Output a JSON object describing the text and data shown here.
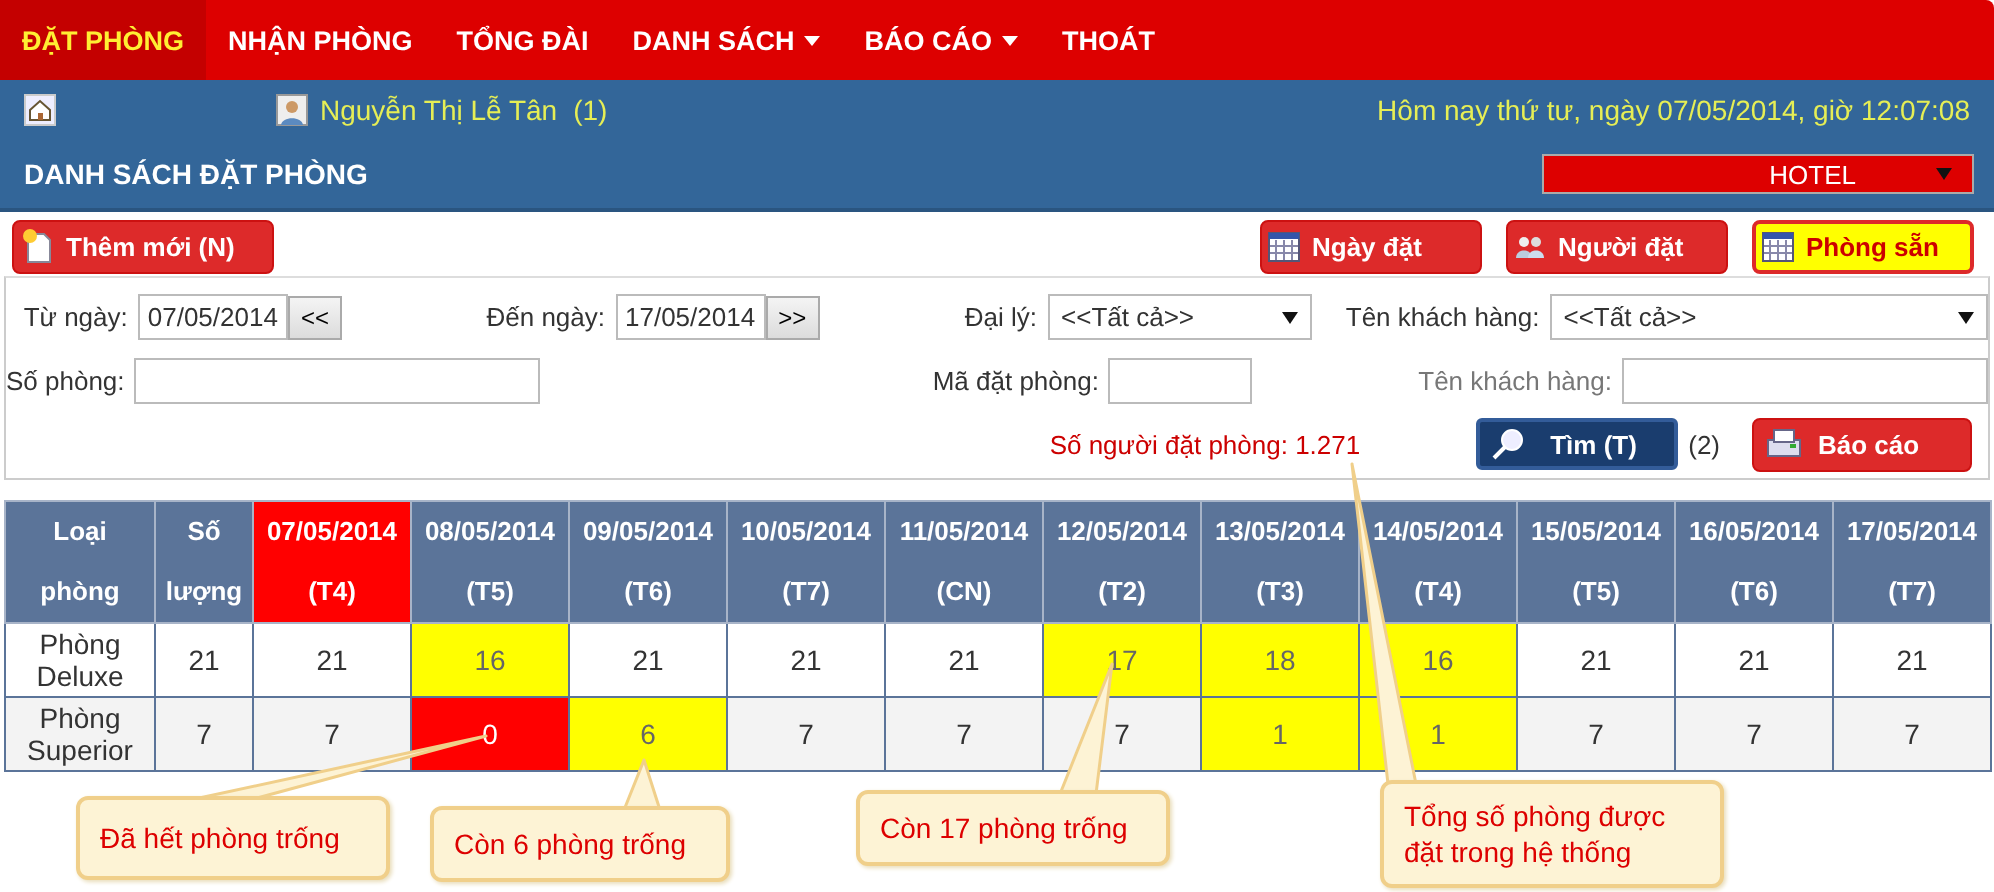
{
  "nav": [
    {
      "label": "ĐẶT PHÒNG",
      "selected": true,
      "dropdown": false
    },
    {
      "label": "NHẬN PHÒNG",
      "selected": false,
      "dropdown": false
    },
    {
      "label": "TỔNG ĐÀI",
      "selected": false,
      "dropdown": false
    },
    {
      "label": "DANH SÁCH",
      "selected": false,
      "dropdown": true
    },
    {
      "label": "BÁO CÁO",
      "selected": false,
      "dropdown": true
    },
    {
      "label": "THOÁT",
      "selected": false,
      "dropdown": false
    }
  ],
  "info_bar": {
    "user": "Nguyễn Thị Lễ Tân",
    "user_count": "(1)",
    "datetime": "Hôm nay thứ tư, ngày 07/05/2014, giờ 12:07:08"
  },
  "page_title": "DANH SÁCH ĐẶT PHÒNG",
  "hotel_select": "HOTEL",
  "toolbar": {
    "add_button": "Thêm mới (N)",
    "views": [
      {
        "label": "Ngày đặt",
        "kind": "calendar",
        "selected": false
      },
      {
        "label": "Người đặt",
        "kind": "people",
        "selected": false
      },
      {
        "label": "Phòng sẵn",
        "kind": "calendar",
        "selected": true
      }
    ]
  },
  "filters": {
    "from_label": "Từ ngày:",
    "from_value": "07/05/2014",
    "prev": "<<",
    "to_label": "Đến ngày:",
    "to_value": "17/05/2014",
    "next": ">>",
    "agent_label": "Đại lý:",
    "agent_value": "<<Tất cả>>",
    "customer_label": "Tên khách hàng:",
    "customer_value": "<<Tất cả>>",
    "room_label": "Số phòng:",
    "code_label": "Mã đặt phòng:",
    "customer_name_label": "Tên khách hàng:",
    "total": "Số người đặt phòng: 1.271",
    "search_button": "Tìm (T)",
    "result_count": "(2)",
    "report_button": "Báo cáo"
  },
  "table": {
    "columns": [
      {
        "line1": "Loại",
        "line2": "phòng",
        "today": false
      },
      {
        "line1": "Số",
        "line2": "lượng",
        "today": false
      },
      {
        "line1": "07/05/2014",
        "line2": "(T4)",
        "today": true
      },
      {
        "line1": "08/05/2014",
        "line2": "(T5)",
        "today": false
      },
      {
        "line1": "09/05/2014",
        "line2": "(T6)",
        "today": false
      },
      {
        "line1": "10/05/2014",
        "line2": "(T7)",
        "today": false
      },
      {
        "line1": "11/05/2014",
        "line2": "(CN)",
        "today": false
      },
      {
        "line1": "12/05/2014",
        "line2": "(T2)",
        "today": false
      },
      {
        "line1": "13/05/2014",
        "line2": "(T3)",
        "today": false
      },
      {
        "line1": "14/05/2014",
        "line2": "(T4)",
        "today": false
      },
      {
        "line1": "15/05/2014",
        "line2": "(T5)",
        "today": false
      },
      {
        "line1": "16/05/2014",
        "line2": "(T6)",
        "today": false
      },
      {
        "line1": "17/05/2014",
        "line2": "(T7)",
        "today": false
      }
    ],
    "rows": [
      {
        "cells": [
          {
            "value": "Phòng Deluxe",
            "kind": "name"
          },
          {
            "value": "21",
            "kind": "normal"
          },
          {
            "value": "21",
            "kind": "normal"
          },
          {
            "value": "16",
            "kind": "low"
          },
          {
            "value": "21",
            "kind": "normal"
          },
          {
            "value": "21",
            "kind": "normal"
          },
          {
            "value": "21",
            "kind": "normal"
          },
          {
            "value": "17",
            "kind": "low"
          },
          {
            "value": "18",
            "kind": "low"
          },
          {
            "value": "16",
            "kind": "low"
          },
          {
            "value": "21",
            "kind": "normal"
          },
          {
            "value": "21",
            "kind": "normal"
          },
          {
            "value": "21",
            "kind": "normal"
          }
        ]
      },
      {
        "cells": [
          {
            "value": "Phòng Superior",
            "kind": "name"
          },
          {
            "value": "7",
            "kind": "normal"
          },
          {
            "value": "7",
            "kind": "normal"
          },
          {
            "value": "0",
            "kind": "full"
          },
          {
            "value": "6",
            "kind": "low"
          },
          {
            "value": "7",
            "kind": "normal"
          },
          {
            "value": "7",
            "kind": "normal"
          },
          {
            "value": "7",
            "kind": "normal"
          },
          {
            "value": "1",
            "kind": "low"
          },
          {
            "value": "1",
            "kind": "low"
          },
          {
            "value": "7",
            "kind": "normal"
          },
          {
            "value": "7",
            "kind": "normal"
          },
          {
            "value": "7",
            "kind": "normal"
          }
        ]
      }
    ]
  },
  "callouts": [
    {
      "text": "Đã hết phòng trống"
    },
    {
      "text": "Còn 6 phòng trống"
    },
    {
      "text": "Còn 17 phòng trống"
    },
    {
      "text": "Tổng số phòng được đặt trong hệ thống"
    }
  ]
}
